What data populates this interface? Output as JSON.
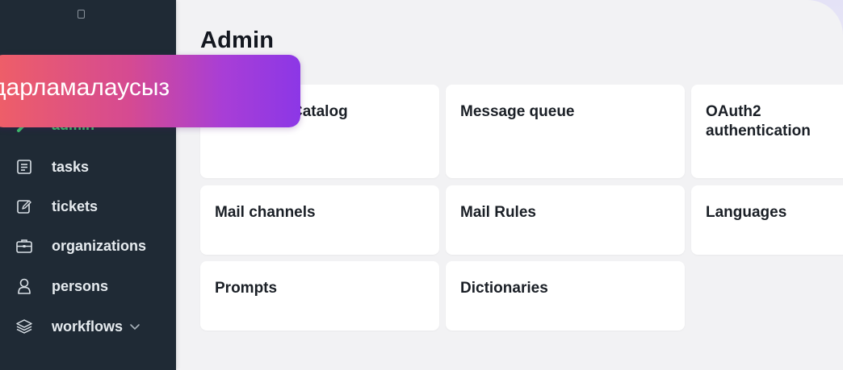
{
  "page": {
    "title": "Admin"
  },
  "sidebar": {
    "collapse_icon": "sidebar-toggle-icon",
    "items": [
      {
        "label": "admin",
        "icon": "wrench-icon",
        "active": true
      },
      {
        "label": "tasks",
        "icon": "list-icon"
      },
      {
        "label": "tickets",
        "icon": "edit-icon"
      },
      {
        "label": "organizations",
        "icon": "briefcase-icon"
      },
      {
        "label": "persons",
        "icon": "person-icon"
      },
      {
        "label": "workflows",
        "icon": "layers-icon",
        "has_submenu": true
      }
    ]
  },
  "cards": [
    {
      "label": "Catalog"
    },
    {
      "label": "Message queue"
    },
    {
      "label": "OAuth2 authentication"
    },
    {
      "label": "Mail channels"
    },
    {
      "label": "Mail Rules"
    },
    {
      "label": "Languages"
    },
    {
      "label": "Prompts"
    },
    {
      "label": "Dictionaries"
    }
  ],
  "banner": {
    "text": "дарламалаусыз"
  },
  "colors": {
    "sidebar_bg": "#1f2a35",
    "active_accent": "#3cc46a",
    "banner_gradient_start": "#ef5f66",
    "banner_gradient_end": "#8c37e6"
  }
}
